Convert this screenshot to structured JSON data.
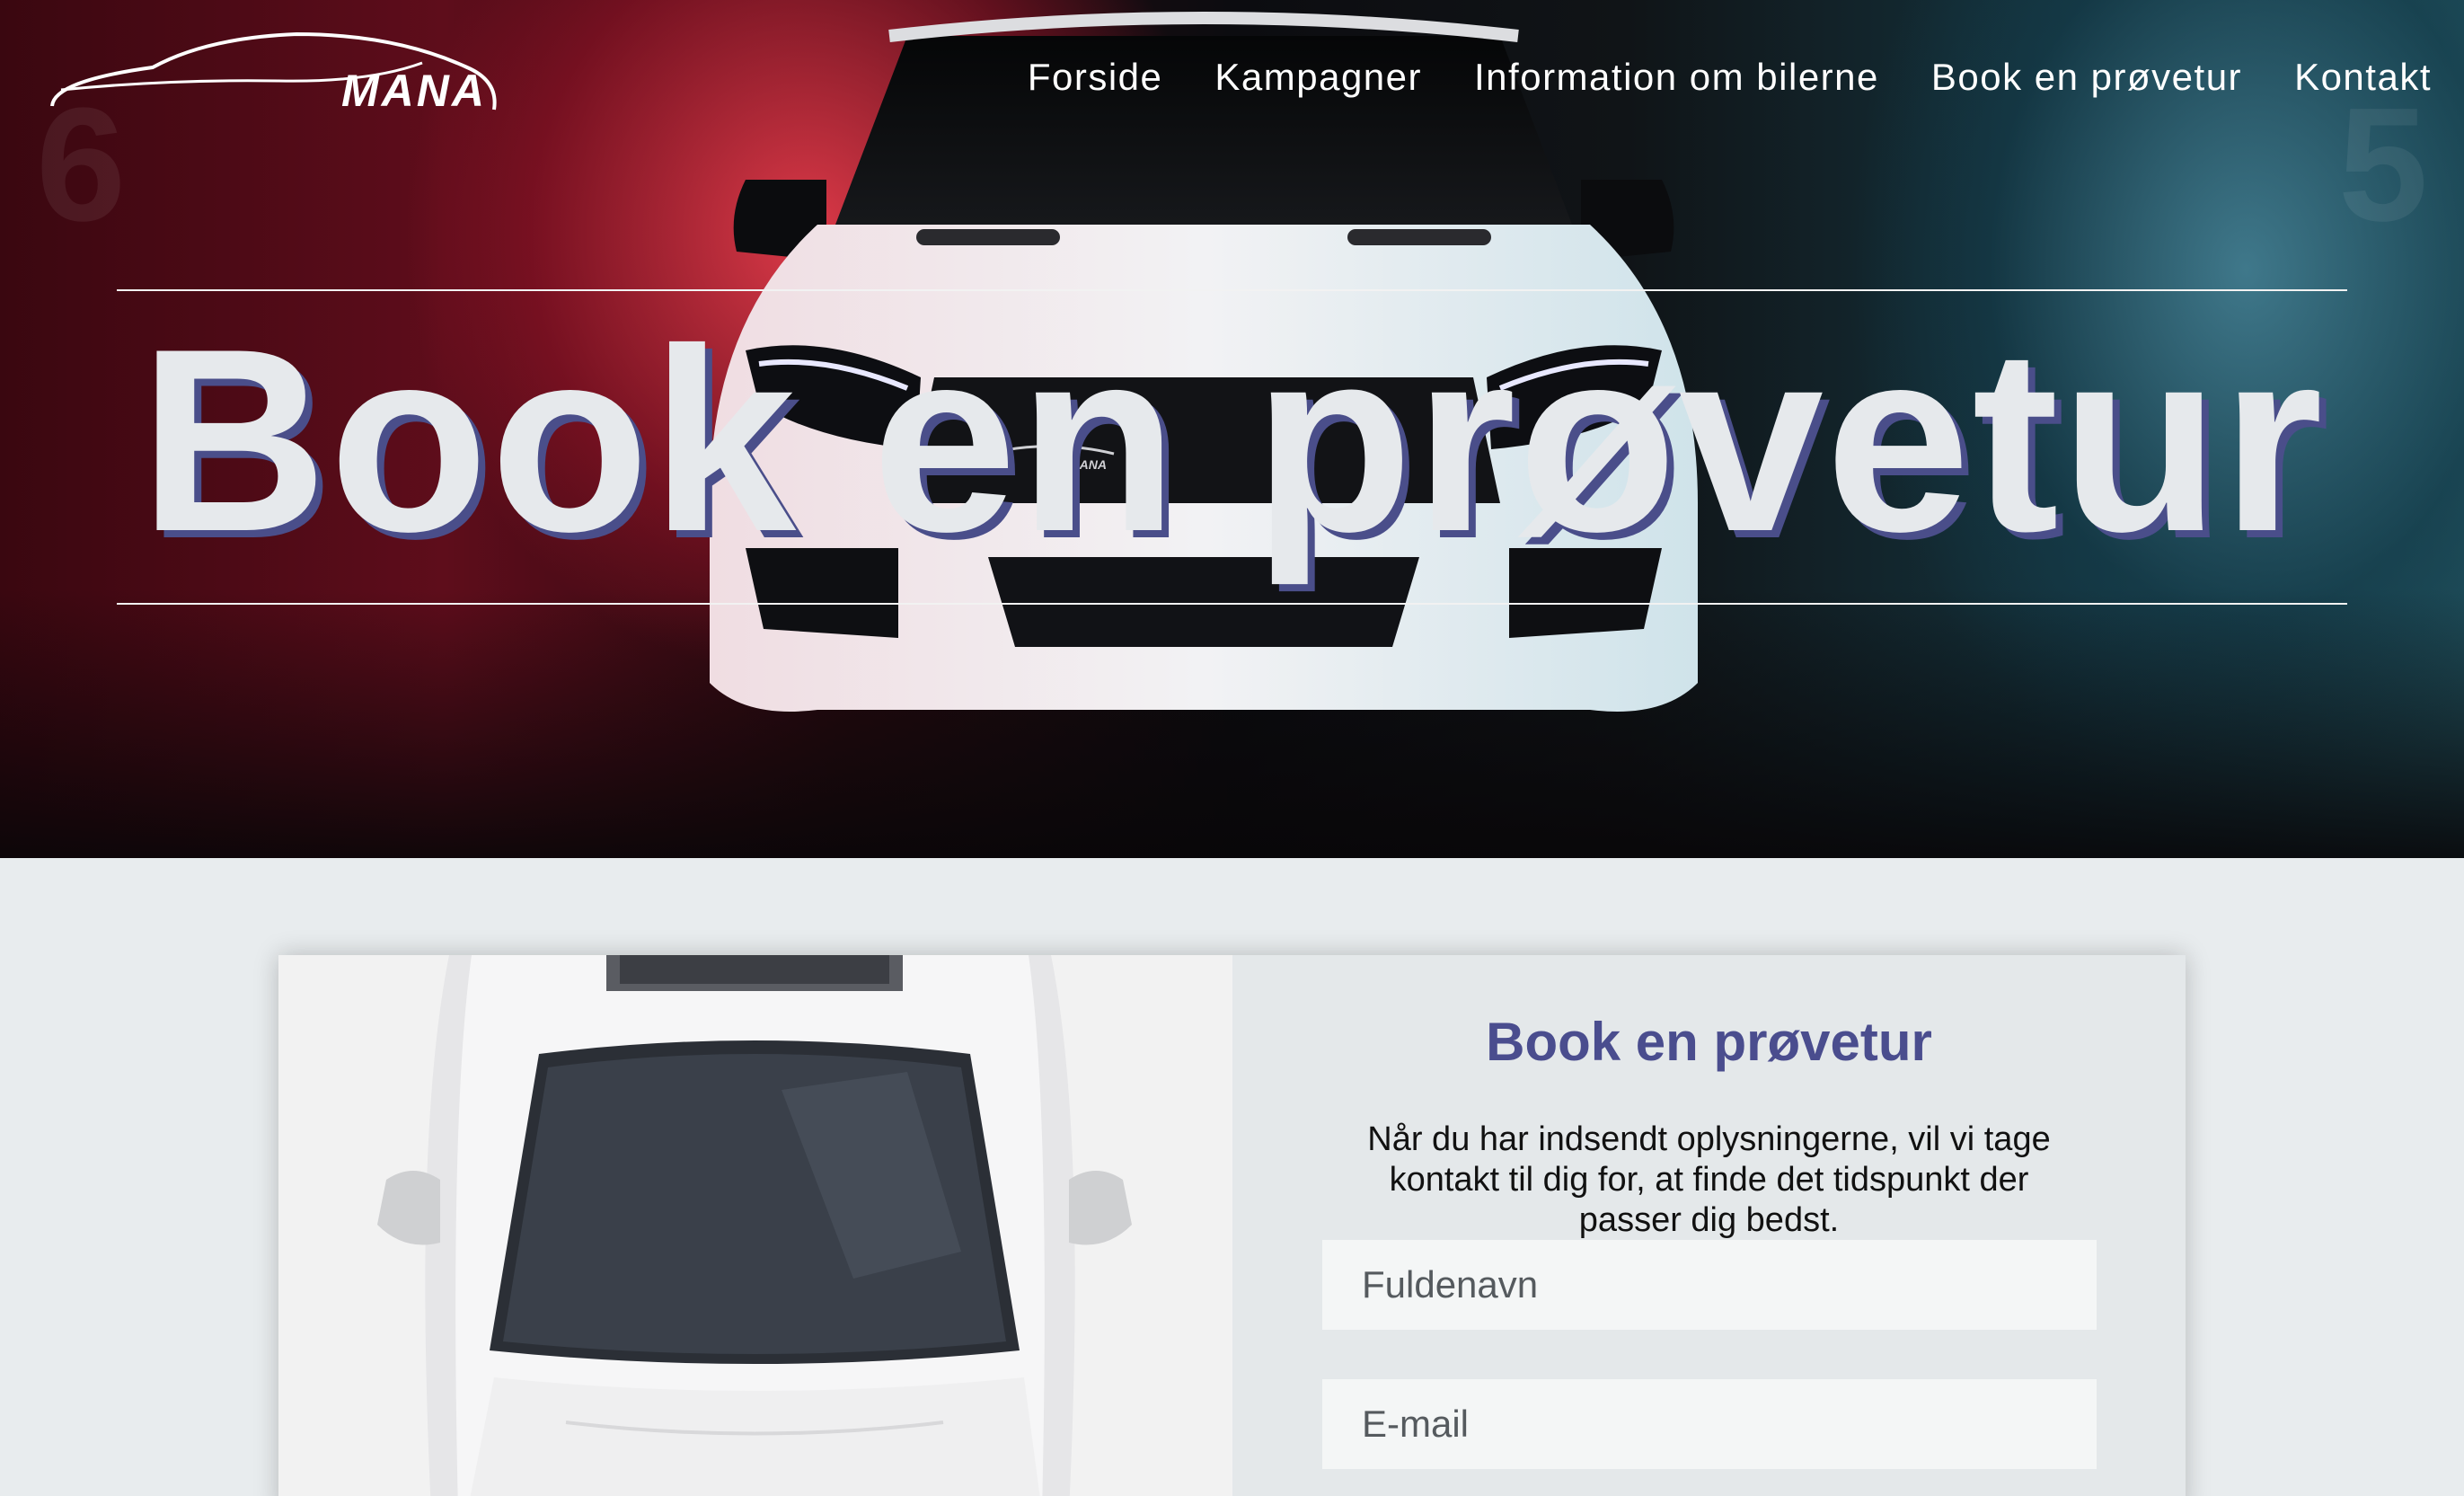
{
  "brand": {
    "name": "MANA"
  },
  "nav": {
    "items": [
      {
        "label": "Forside"
      },
      {
        "label": "Kampagner"
      },
      {
        "label": "Information om bilerne"
      },
      {
        "label": "Book en prøvetur"
      },
      {
        "label": "Kontakt"
      }
    ]
  },
  "hero": {
    "title": "Book en prøvetur",
    "background_left": "6",
    "background_right": "5"
  },
  "booking": {
    "title": "Book en prøvetur",
    "description": "Når du har indsendt oplysningerne, vil vi tage kontakt til dig for, at finde det tidspunkt der passer dig bedst.",
    "fields": {
      "name_placeholder": "Fuldenavn",
      "email_placeholder": "E-mail"
    }
  },
  "colors": {
    "accent": "#4a4d8e",
    "page_background": "#e8ecee",
    "hero_red": "#5e0d1b",
    "hero_teal": "#20505c"
  }
}
